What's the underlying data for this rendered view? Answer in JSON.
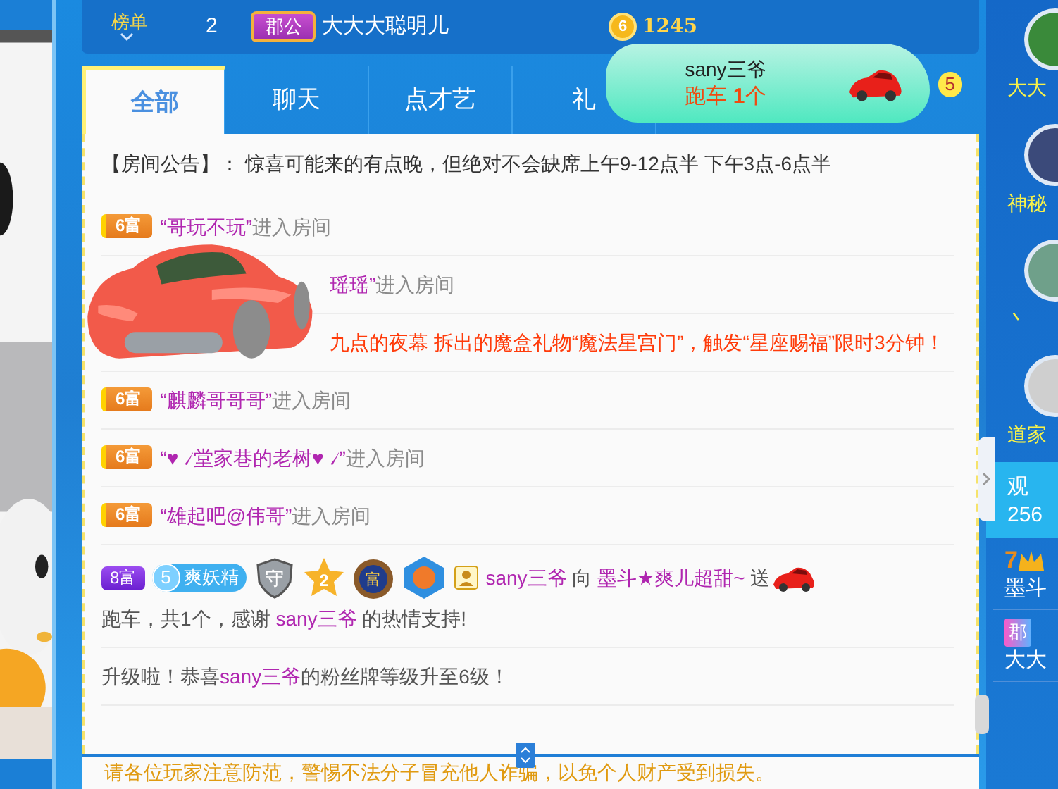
{
  "top_bar": {
    "rank_label": "榜单",
    "rank": "2",
    "title_badge": "郡公",
    "username": "大大大聪明儿",
    "coin_level": "6",
    "coins": "1245"
  },
  "tabs": [
    {
      "label": "全部",
      "selected": true
    },
    {
      "label": "聊天",
      "selected": false
    },
    {
      "label": "点才艺",
      "selected": false
    },
    {
      "label": "礼",
      "selected": false
    }
  ],
  "tab_badge": "5",
  "toast": {
    "user": "sany三爷",
    "gift": "跑车 **1**个"
  },
  "messages": [
    {
      "kind": "announce",
      "parts": [
        {
          "kind": "plain",
          "text": "【房间公告】： 惊喜可能来的有点晚，但绝对不会缺席上午9-12点半 下午3点-6点半"
        }
      ]
    },
    {
      "kind": "enter",
      "badge": "6富",
      "parts": [
        {
          "kind": "name",
          "text": "“哥玩不玩”"
        },
        {
          "kind": "muted",
          "text": "进入房间"
        }
      ]
    },
    {
      "kind": "picture"
    },
    {
      "kind": "enter",
      "parts": [
        {
          "kind": "name",
          "text": "瑶瑶”"
        },
        {
          "kind": "muted",
          "text": "进入房间"
        }
      ]
    },
    {
      "kind": "system",
      "parts": [
        {
          "kind": "alert",
          "text": "九点的夜幕 拆出的魔盒礼物“魔法星宫门”，触发“星座赐福”限时3分钟！"
        }
      ]
    },
    {
      "kind": "enter",
      "badge": "6富",
      "parts": [
        {
          "kind": "name",
          "text": "“麒麟哥哥哥”"
        },
        {
          "kind": "muted",
          "text": "进入房间"
        }
      ]
    },
    {
      "kind": "enter",
      "badge": "6富",
      "parts": [
        {
          "kind": "name",
          "text": "“♥ ৴堂家巷的老树♥ ৴”"
        },
        {
          "kind": "muted",
          "text": "进入房间"
        }
      ]
    },
    {
      "kind": "enter",
      "badge": "6富",
      "parts": [
        {
          "kind": "name",
          "text": "“雄起吧@伟哥”"
        },
        {
          "kind": "muted",
          "text": "进入房间"
        }
      ]
    },
    {
      "kind": "gift",
      "badges": [
        {
          "kind": "wealth",
          "text": "8富"
        },
        {
          "kind": "fan",
          "level": "5",
          "text": "爽妖精"
        },
        {
          "kind": "shield",
          "text": "守"
        },
        {
          "kind": "star",
          "text": "2"
        },
        {
          "kind": "medal",
          "text": "富"
        },
        {
          "kind": "hexagon"
        },
        {
          "kind": "user"
        }
      ],
      "parts": [
        {
          "kind": "name",
          "text": "sany三爷"
        },
        {
          "kind": "plain",
          "text": " 向 "
        },
        {
          "kind": "name",
          "text": "墨斗★爽儿超甜~"
        },
        {
          "kind": "plain",
          "text": " 送 "
        },
        {
          "kind": "car"
        },
        {
          "kind": "break"
        },
        {
          "kind": "plain",
          "text": "跑车，共1个，感谢 "
        },
        {
          "kind": "name",
          "text": "sany三爷"
        },
        {
          "kind": "plain",
          "text": " 的热情支持!"
        }
      ]
    },
    {
      "kind": "levelup",
      "parts": [
        {
          "kind": "plain",
          "text": "升级啦！恭喜"
        },
        {
          "kind": "name",
          "text": "sany三爷"
        },
        {
          "kind": "plain",
          "text": "的粉丝牌等级升至6级！"
        }
      ]
    }
  ],
  "notice": "请各位玩家注意防范，警惕不法分子冒充他人诈骗，以免个人财产受到损失。",
  "sidebar": {
    "guests": [
      {
        "name": "大大"
      },
      {
        "name": "神秘"
      },
      {
        "name": "丶"
      },
      {
        "name": "道家"
      }
    ],
    "viewers_label": "观",
    "viewers": "256",
    "ranks": [
      {
        "kind": "crown",
        "level": "7",
        "name": "墨斗"
      },
      {
        "kind": "badge",
        "badge": "郡",
        "name": "大大"
      }
    ]
  }
}
